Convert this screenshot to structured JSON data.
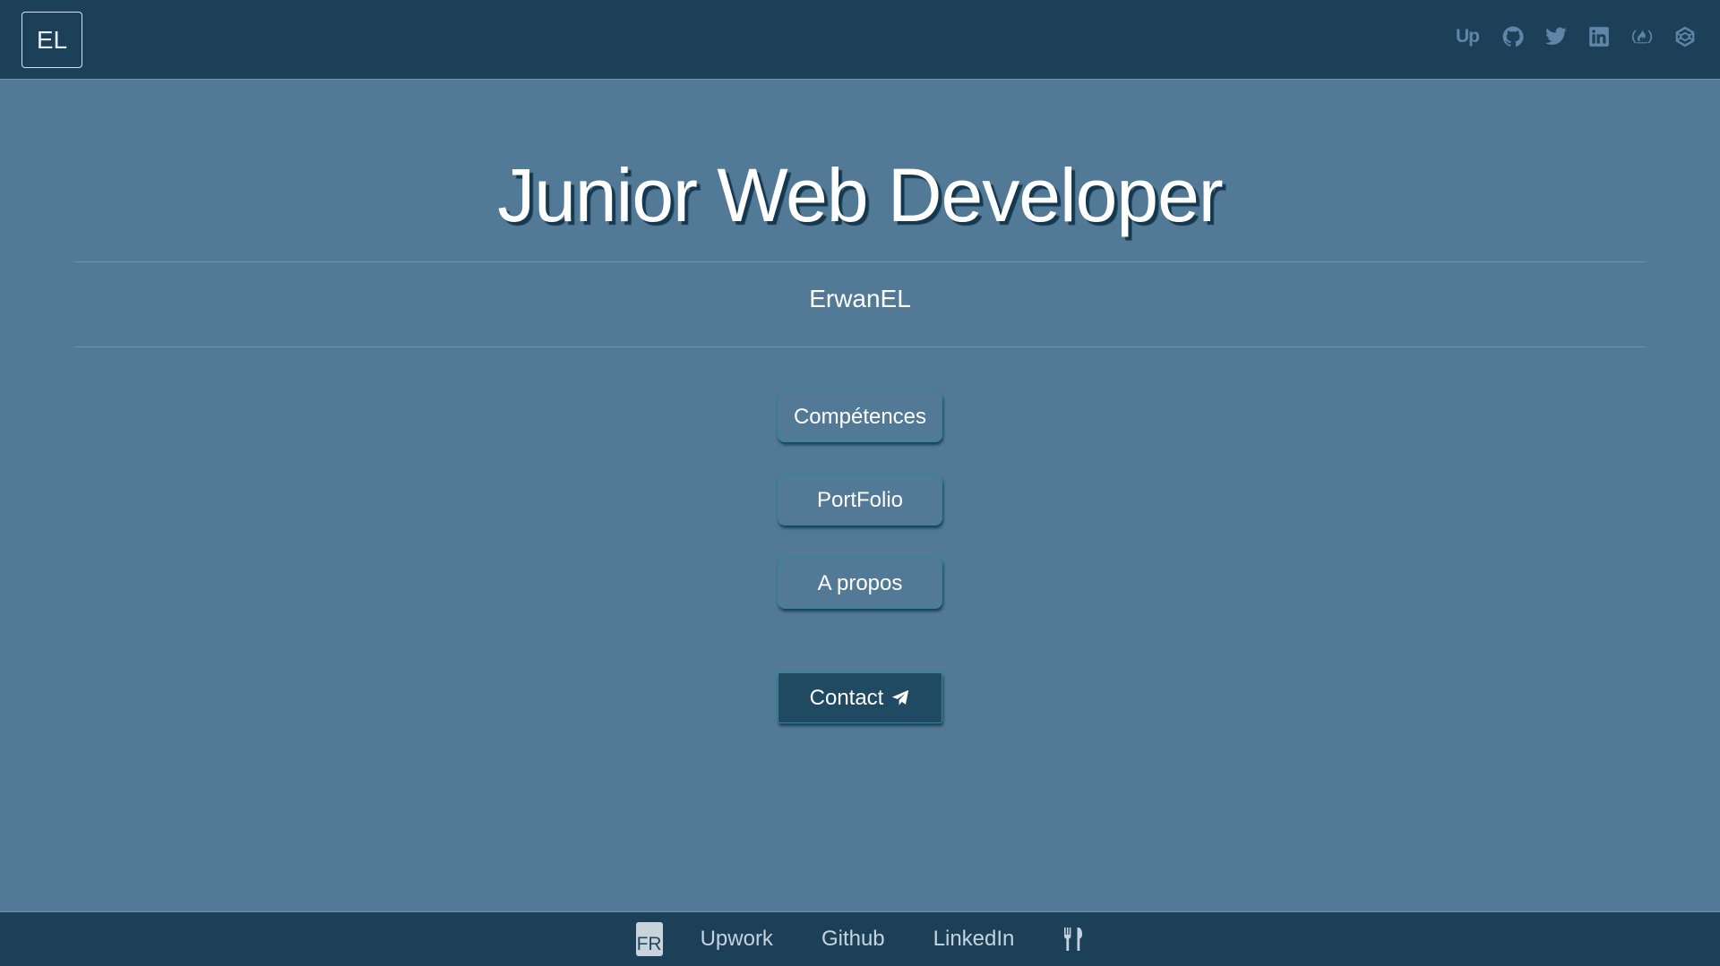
{
  "header": {
    "logo": "EL",
    "social_icons": [
      {
        "icon": "upwork-icon",
        "label": "Up"
      },
      {
        "icon": "github-icon"
      },
      {
        "icon": "twitter-icon"
      },
      {
        "icon": "linkedin-icon"
      },
      {
        "icon": "freecodecamp-icon"
      },
      {
        "icon": "codepen-icon"
      }
    ]
  },
  "main": {
    "title": "Junior Web Developer",
    "subtitle": "ErwanEL",
    "buttons": {
      "skills": "Compétences",
      "portfolio": "PortFolio",
      "about": "A propos",
      "contact": "Contact"
    }
  },
  "footer": {
    "lang": "FR",
    "links": {
      "upwork": "Upwork",
      "github": "Github",
      "linkedin": "LinkedIn"
    },
    "extra_icon": "utensils-icon"
  },
  "colors": {
    "header_bg": "#1b4058",
    "page_bg": "#527a96",
    "icon": "#5f86a8",
    "button_border": "#2a8aa0"
  }
}
